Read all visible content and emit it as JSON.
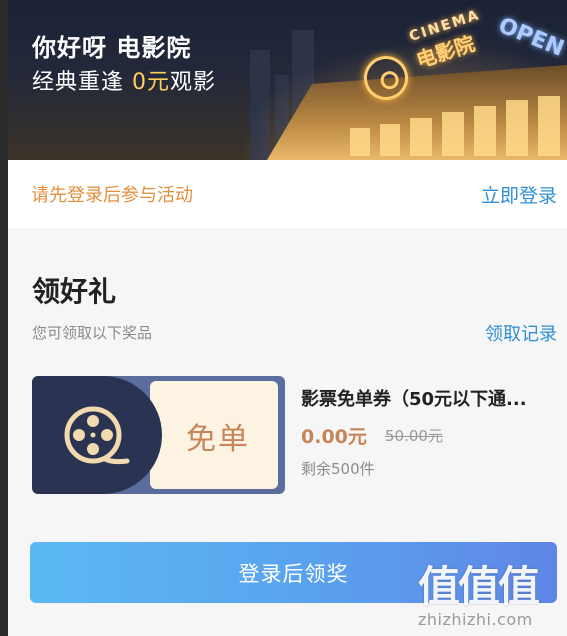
{
  "banner": {
    "title": "你好呀 电影院",
    "subtitle_before": "经典重逢 ",
    "subtitle_accent": "0元",
    "subtitle_after": "观影",
    "sign_cinema": "CINEMA",
    "sign_logo": "电影院",
    "sign_open": "OPEN"
  },
  "login_bar": {
    "tip": "请先登录后参与活动",
    "link": "立即登录"
  },
  "gift": {
    "title": "领好礼",
    "subtitle": "您可领取以下奖品",
    "record_link": "领取记录"
  },
  "prize": {
    "coupon_label": "免单",
    "icon": "film-reel-icon",
    "name": "影票免单券（50元以下通...",
    "price": "0.00元",
    "original_price": "50.00元",
    "stock": "剩余500件"
  },
  "claim_button": "登录后领奖",
  "watermark": {
    "logo": "值值值",
    "url": "zhizhizhi.com"
  },
  "colors": {
    "accent_orange": "#e58e3c",
    "link_blue": "#2f8fd6",
    "price_gold": "#c6865a",
    "coupon_navy": "#2a3452",
    "button_gradient_start": "#5bb8f4",
    "button_gradient_end": "#5f86e6"
  }
}
